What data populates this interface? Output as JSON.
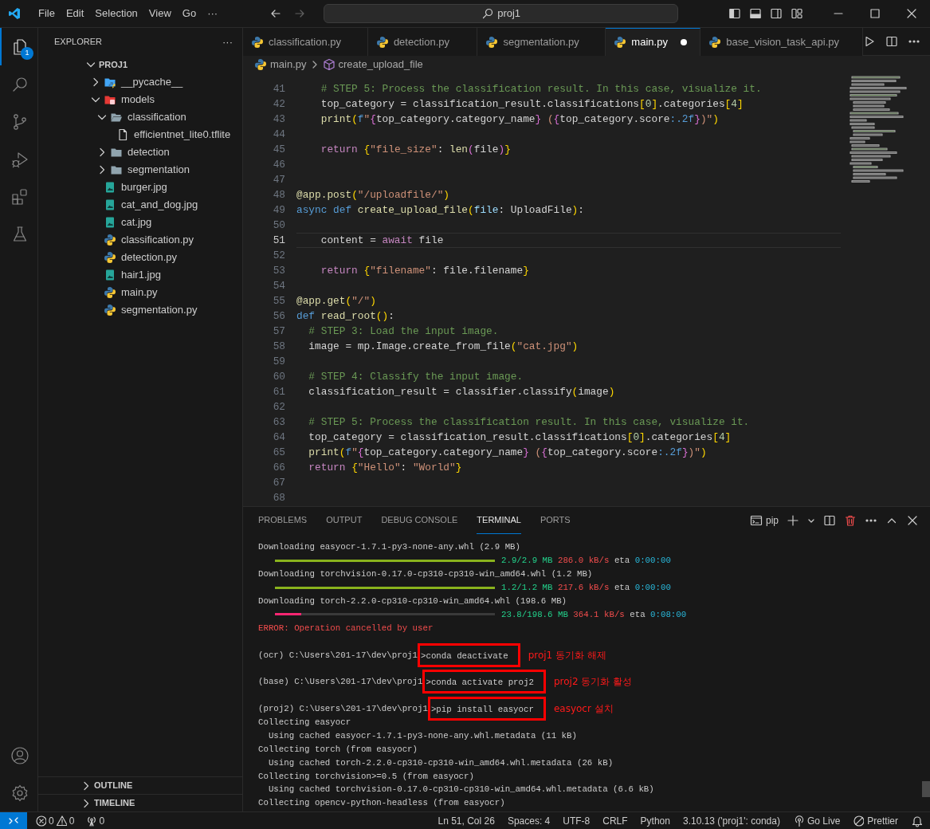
{
  "title_bar": {
    "menu": [
      "File",
      "Edit",
      "Selection",
      "View",
      "Go",
      "···"
    ],
    "search": "proj1"
  },
  "activity_bar": {
    "top": [
      {
        "kind": "explorer",
        "selected": true,
        "badge": "1"
      },
      {
        "kind": "search",
        "selected": false
      },
      {
        "kind": "source_control",
        "selected": false
      },
      {
        "kind": "run_debug",
        "selected": false
      },
      {
        "kind": "extensions",
        "selected": false
      },
      {
        "kind": "testing",
        "selected": false
      }
    ],
    "bottom": [
      {
        "kind": "account"
      },
      {
        "kind": "settings"
      }
    ]
  },
  "sidebar": {
    "title": "EXPLORER",
    "more": "···",
    "tree": {
      "label": "PROJ1",
      "expanded": true,
      "children": [
        {
          "label": "__pycache__",
          "kind": "folder_py",
          "expanded": false
        },
        {
          "label": "models",
          "kind": "folder_models",
          "expanded": true,
          "children": [
            {
              "label": "classification",
              "kind": "folder",
              "expanded": true,
              "children": [
                {
                  "label": "efficientnet_lite0.tflite",
                  "kind": "file"
                }
              ]
            },
            {
              "label": "detection",
              "kind": "folder",
              "expanded": false
            },
            {
              "label": "segmentation",
              "kind": "folder",
              "expanded": false
            }
          ]
        },
        {
          "label": "burger.jpg",
          "kind": "image"
        },
        {
          "label": "cat_and_dog.jpg",
          "kind": "image"
        },
        {
          "label": "cat.jpg",
          "kind": "image"
        },
        {
          "label": "classification.py",
          "kind": "python"
        },
        {
          "label": "detection.py",
          "kind": "python"
        },
        {
          "label": "hair1.jpg",
          "kind": "image"
        },
        {
          "label": "main.py",
          "kind": "python"
        },
        {
          "label": "segmentation.py",
          "kind": "python"
        }
      ]
    },
    "sections": [
      {
        "label": "OUTLINE",
        "expanded": false
      },
      {
        "label": "TIMELINE",
        "expanded": false
      }
    ]
  },
  "editor": {
    "tabs": [
      {
        "label": "classification.py",
        "selected": false,
        "modified": false
      },
      {
        "label": "detection.py",
        "selected": false,
        "modified": false
      },
      {
        "label": "segmentation.py",
        "selected": false,
        "modified": false
      },
      {
        "label": "main.py",
        "selected": true,
        "modified": true
      },
      {
        "label": "base_vision_task_api.py",
        "selected": false,
        "modified": false
      }
    ],
    "breadcrumb": [
      "main.py",
      "create_upload_file"
    ],
    "lines": [
      {
        "number": "41",
        "current": false,
        "tokens": [
          {
            "kind": "com",
            "text": "    # STEP 5: Process the classification result. In this case, visualize it."
          }
        ]
      },
      {
        "number": "42",
        "current": false,
        "tokens": [
          {
            "kind": "plain",
            "text": "    top_category = classification_result.classifications"
          },
          {
            "kind": "br1",
            "text": "["
          },
          {
            "kind": "num",
            "text": "0"
          },
          {
            "kind": "br1",
            "text": "]"
          },
          {
            "kind": "plain",
            "text": ".categories"
          },
          {
            "kind": "br1",
            "text": "["
          },
          {
            "kind": "num",
            "text": "4"
          },
          {
            "kind": "br1",
            "text": "]"
          }
        ]
      },
      {
        "number": "43",
        "current": false,
        "tokens": [
          {
            "kind": "fn",
            "text": "    print"
          },
          {
            "kind": "br1",
            "text": "("
          },
          {
            "kind": "kw",
            "text": "f"
          },
          {
            "kind": "str",
            "text": "\""
          },
          {
            "kind": "br2",
            "text": "{"
          },
          {
            "kind": "plain",
            "text": "top_category.category_name"
          },
          {
            "kind": "br2",
            "text": "}"
          },
          {
            "kind": "str",
            "text": " ("
          },
          {
            "kind": "br2",
            "text": "{"
          },
          {
            "kind": "plain",
            "text": "top_category.score"
          },
          {
            "kind": "kw",
            "text": ":.2f"
          },
          {
            "kind": "br2",
            "text": "}"
          },
          {
            "kind": "str",
            "text": ")\""
          },
          {
            "kind": "br1",
            "text": ")"
          }
        ]
      },
      {
        "number": "44",
        "current": false
      },
      {
        "number": "45",
        "current": false,
        "tokens": [
          {
            "kind": "ctrl",
            "text": "    return "
          },
          {
            "kind": "br1",
            "text": "{"
          },
          {
            "kind": "str",
            "text": "\"file_size\""
          },
          {
            "kind": "plain",
            "text": ": "
          },
          {
            "kind": "fn",
            "text": "len"
          },
          {
            "kind": "br2",
            "text": "("
          },
          {
            "kind": "plain",
            "text": "file"
          },
          {
            "kind": "br2",
            "text": ")"
          },
          {
            "kind": "br1",
            "text": "}"
          }
        ]
      },
      {
        "number": "46",
        "current": false
      },
      {
        "number": "47",
        "current": false
      },
      {
        "number": "48",
        "current": false,
        "tokens": [
          {
            "kind": "fn",
            "text": "@app.post"
          },
          {
            "kind": "br1",
            "text": "("
          },
          {
            "kind": "str",
            "text": "\"/uploadfile/\""
          },
          {
            "kind": "br1",
            "text": ")"
          }
        ]
      },
      {
        "number": "49",
        "current": false,
        "tokens": [
          {
            "kind": "kw",
            "text": "async def "
          },
          {
            "kind": "fn",
            "text": "create_upload_file"
          },
          {
            "kind": "br1",
            "text": "("
          },
          {
            "kind": "var",
            "text": "file"
          },
          {
            "kind": "plain",
            "text": ": UploadFile"
          },
          {
            "kind": "br1",
            "text": ")"
          },
          {
            "kind": "plain",
            "text": ":"
          }
        ]
      },
      {
        "number": "50",
        "current": false
      },
      {
        "number": "51",
        "current": true,
        "tokens": [
          {
            "kind": "plain",
            "text": "    content = "
          },
          {
            "kind": "ctrl",
            "text": "await"
          },
          {
            "kind": "plain",
            "text": " file"
          }
        ]
      },
      {
        "number": "52",
        "current": false
      },
      {
        "number": "53",
        "current": false,
        "tokens": [
          {
            "kind": "ctrl",
            "text": "    return "
          },
          {
            "kind": "br1",
            "text": "{"
          },
          {
            "kind": "str",
            "text": "\"filename\""
          },
          {
            "kind": "plain",
            "text": ": file.filename"
          },
          {
            "kind": "br1",
            "text": "}"
          }
        ]
      },
      {
        "number": "54",
        "current": false
      },
      {
        "number": "55",
        "current": false,
        "tokens": [
          {
            "kind": "fn",
            "text": "@app.get"
          },
          {
            "kind": "br1",
            "text": "("
          },
          {
            "kind": "str",
            "text": "\"/\""
          },
          {
            "kind": "br1",
            "text": ")"
          }
        ]
      },
      {
        "number": "56",
        "current": false,
        "tokens": [
          {
            "kind": "kw",
            "text": "def "
          },
          {
            "kind": "fn",
            "text": "read_root"
          },
          {
            "kind": "br1",
            "text": "()"
          },
          {
            "kind": "plain",
            "text": ":"
          }
        ]
      },
      {
        "number": "57",
        "current": false,
        "tokens": [
          {
            "kind": "com",
            "text": "  # STEP 3: Load the input image."
          }
        ]
      },
      {
        "number": "58",
        "current": false,
        "tokens": [
          {
            "kind": "plain",
            "text": "  image = mp.Image.create_from_file"
          },
          {
            "kind": "br1",
            "text": "("
          },
          {
            "kind": "str",
            "text": "\"cat.jpg\""
          },
          {
            "kind": "br1",
            "text": ")"
          }
        ]
      },
      {
        "number": "59",
        "current": false
      },
      {
        "number": "60",
        "current": false,
        "tokens": [
          {
            "kind": "com",
            "text": "  # STEP 4: Classify the input image."
          }
        ]
      },
      {
        "number": "61",
        "current": false,
        "tokens": [
          {
            "kind": "plain",
            "text": "  classification_result = classifier.classify"
          },
          {
            "kind": "br1",
            "text": "("
          },
          {
            "kind": "plain",
            "text": "image"
          },
          {
            "kind": "br1",
            "text": ")"
          }
        ]
      },
      {
        "number": "62",
        "current": false
      },
      {
        "number": "63",
        "current": false,
        "tokens": [
          {
            "kind": "com",
            "text": "  # STEP 5: Process the classification result. In this case, visualize it."
          }
        ]
      },
      {
        "number": "64",
        "current": false,
        "tokens": [
          {
            "kind": "plain",
            "text": "  top_category = classification_result.classifications"
          },
          {
            "kind": "br1",
            "text": "["
          },
          {
            "kind": "num",
            "text": "0"
          },
          {
            "kind": "br1",
            "text": "]"
          },
          {
            "kind": "plain",
            "text": ".categories"
          },
          {
            "kind": "br1",
            "text": "["
          },
          {
            "kind": "num",
            "text": "4"
          },
          {
            "kind": "br1",
            "text": "]"
          }
        ]
      },
      {
        "number": "65",
        "current": false,
        "tokens": [
          {
            "kind": "fn",
            "text": "  print"
          },
          {
            "kind": "br1",
            "text": "("
          },
          {
            "kind": "kw",
            "text": "f"
          },
          {
            "kind": "str",
            "text": "\""
          },
          {
            "kind": "br2",
            "text": "{"
          },
          {
            "kind": "plain",
            "text": "top_category.category_name"
          },
          {
            "kind": "br2",
            "text": "}"
          },
          {
            "kind": "str",
            "text": " ("
          },
          {
            "kind": "br2",
            "text": "{"
          },
          {
            "kind": "plain",
            "text": "top_category.score"
          },
          {
            "kind": "kw",
            "text": ":.2f"
          },
          {
            "kind": "br2",
            "text": "}"
          },
          {
            "kind": "str",
            "text": ")\""
          },
          {
            "kind": "br1",
            "text": ")"
          }
        ]
      },
      {
        "number": "66",
        "current": false,
        "tokens": [
          {
            "kind": "ctrl",
            "text": "  return "
          },
          {
            "kind": "br1",
            "text": "{"
          },
          {
            "kind": "str",
            "text": "\"Hello\""
          },
          {
            "kind": "plain",
            "text": ": "
          },
          {
            "kind": "str",
            "text": "\"World\""
          },
          {
            "kind": "br1",
            "text": "}"
          }
        ]
      },
      {
        "number": "67",
        "current": false
      },
      {
        "number": "68",
        "current": false
      }
    ]
  },
  "panel": {
    "tabs": [
      {
        "label": "PROBLEMS",
        "selected": false
      },
      {
        "label": "OUTPUT",
        "selected": false
      },
      {
        "label": "DEBUG CONSOLE",
        "selected": false
      },
      {
        "label": "TERMINAL",
        "selected": true
      },
      {
        "label": "PORTS",
        "selected": false
      }
    ],
    "terminal_name": "pip",
    "lines": [
      {
        "kind": "text",
        "text": "Downloading easyocr-1.7.1-py3-none-any.whl (2.9 MB)"
      },
      {
        "kind": "progress",
        "level": 1,
        "done": "2.9/2.9 MB",
        "speed": "286.0 kB/s",
        "eta_label": "eta",
        "eta": "0:00:00"
      },
      {
        "kind": "text",
        "text": "Downloading torchvision-0.17.0-cp310-cp310-win_amd64.whl (1.2 MB)"
      },
      {
        "kind": "progress",
        "level": 1,
        "done": "1.2/1.2 MB",
        "speed": "217.6 kB/s",
        "eta_label": "eta",
        "eta": "0:00:00"
      },
      {
        "kind": "text",
        "text": "Downloading torch-2.2.0-cp310-cp310-win_amd64.whl (198.6 MB)"
      },
      {
        "kind": "progress",
        "level": 0.12,
        "done": "23.8/198.6 MB",
        "speed": "364.1 kB/s",
        "eta_label": "eta",
        "eta": "0:08:00"
      },
      {
        "kind": "error",
        "text": "ERROR: Operation cancelled by user"
      },
      {
        "kind": "blank"
      },
      {
        "kind": "prompt",
        "prefix": "(ocr) C:\\Users\\201-17\\dev\\proj1",
        "command": ">conda deactivate",
        "note": "proj1 동기화 해제"
      },
      {
        "kind": "blank"
      },
      {
        "kind": "prompt",
        "prefix": "(base) C:\\Users\\201-17\\dev\\proj1",
        "command": ">conda activate proj2",
        "note": "proj2 동기화 활성"
      },
      {
        "kind": "blank"
      },
      {
        "kind": "prompt",
        "prefix": "(proj2) C:\\Users\\201-17\\dev\\proj1",
        "command": ">pip install easyocr",
        "note": "easyocr 설치"
      },
      {
        "kind": "text",
        "text": "Collecting easyocr"
      },
      {
        "kind": "text",
        "text": "  Using cached easyocr-1.7.1-py3-none-any.whl.metadata (11 kB)"
      },
      {
        "kind": "text",
        "text": "Collecting torch (from easyocr)"
      },
      {
        "kind": "text",
        "text": "  Using cached torch-2.2.0-cp310-cp310-win_amd64.whl.metadata (26 kB)"
      },
      {
        "kind": "text",
        "text": "Collecting torchvision>=0.5 (from easyocr)"
      },
      {
        "kind": "text",
        "text": "  Using cached torchvision-0.17.0-cp310-cp310-win_amd64.whl.metadata (6.6 kB)"
      },
      {
        "kind": "text",
        "text": "Collecting opencv-python-headless (from easyocr)"
      }
    ]
  },
  "status_bar": {
    "left": [
      {
        "kind": "remote"
      },
      {
        "kind": "errors",
        "text": "0"
      },
      {
        "kind": "warnings",
        "text": "0"
      },
      {
        "kind": "ports",
        "text": "0"
      }
    ],
    "right": [
      {
        "kind": "text",
        "text": "Ln 51, Col 26"
      },
      {
        "kind": "text",
        "text": "Spaces: 4"
      },
      {
        "kind": "text",
        "text": "UTF-8"
      },
      {
        "kind": "text",
        "text": "CRLF"
      },
      {
        "kind": "text",
        "text": "Python"
      },
      {
        "kind": "text",
        "text": "3.10.13 ('proj1': conda)"
      },
      {
        "kind": "golive",
        "text": "Go Live"
      },
      {
        "kind": "prettier",
        "text": "Prettier"
      },
      {
        "kind": "bell"
      }
    ]
  }
}
